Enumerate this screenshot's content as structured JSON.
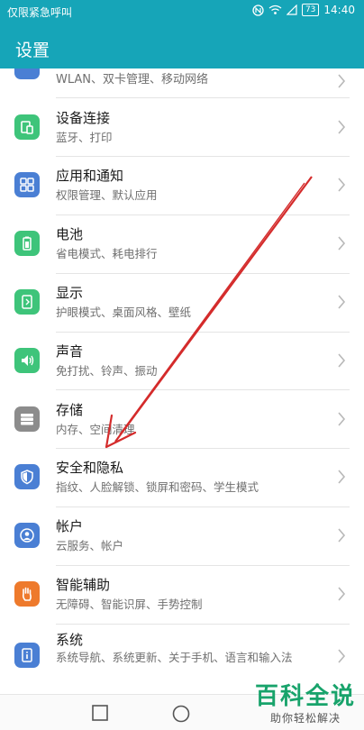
{
  "status": {
    "carrier_text": "仅限紧急呼叫",
    "battery": "73",
    "time": "14:40"
  },
  "header": {
    "title": "设置"
  },
  "settings": {
    "items": [
      {
        "title": "",
        "subtitle": "WLAN、双卡管理、移动网络",
        "icon": "network-icon"
      },
      {
        "title": "设备连接",
        "subtitle": "蓝牙、打印",
        "icon": "device-connect-icon"
      },
      {
        "title": "应用和通知",
        "subtitle": "权限管理、默认应用",
        "icon": "apps-icon"
      },
      {
        "title": "电池",
        "subtitle": "省电模式、耗电排行",
        "icon": "battery-icon"
      },
      {
        "title": "显示",
        "subtitle": "护眼模式、桌面风格、壁纸",
        "icon": "display-icon"
      },
      {
        "title": "声音",
        "subtitle": "免打扰、铃声、振动",
        "icon": "sound-icon"
      },
      {
        "title": "存储",
        "subtitle": "内存、空间清理",
        "icon": "storage-icon"
      },
      {
        "title": "安全和隐私",
        "subtitle": "指纹、人脸解锁、锁屏和密码、学生模式",
        "icon": "shield-icon"
      },
      {
        "title": "帐户",
        "subtitle": "云服务、帐户",
        "icon": "account-icon"
      },
      {
        "title": "智能辅助",
        "subtitle": "无障碍、智能识屏、手势控制",
        "icon": "hand-icon"
      },
      {
        "title": "系统",
        "subtitle": "系统导航、系统更新、关于手机、语言和输入法",
        "icon": "system-icon"
      }
    ]
  },
  "watermark": {
    "big": "百科全说",
    "small": "助你轻松解决"
  },
  "colors": {
    "accent": "#16a5b8",
    "green_icon": "#3ec47a",
    "blue_icon": "#4a7fd4",
    "gray_icon": "#8c8c8c",
    "orange_icon": "#ee7a2c"
  }
}
